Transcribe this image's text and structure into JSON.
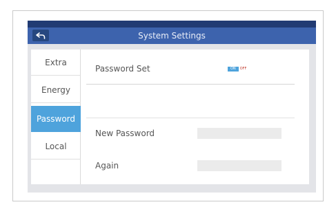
{
  "header": {
    "title": "System Settings"
  },
  "sidebar": {
    "items": [
      {
        "label": "Extra",
        "active": false
      },
      {
        "label": "Energy",
        "active": false
      },
      {
        "label": "Password",
        "active": true
      },
      {
        "label": "Local",
        "active": false
      }
    ]
  },
  "main": {
    "password_set_label": "Password Set",
    "toggle": {
      "on_label": "ON",
      "off_label": "OFF",
      "state": "on"
    },
    "new_password_label": "New Password",
    "new_password_value": "",
    "again_label": "Again",
    "again_value": ""
  },
  "colors": {
    "title_bar": "#3d63ad",
    "active_tab": "#4ea3dc"
  }
}
